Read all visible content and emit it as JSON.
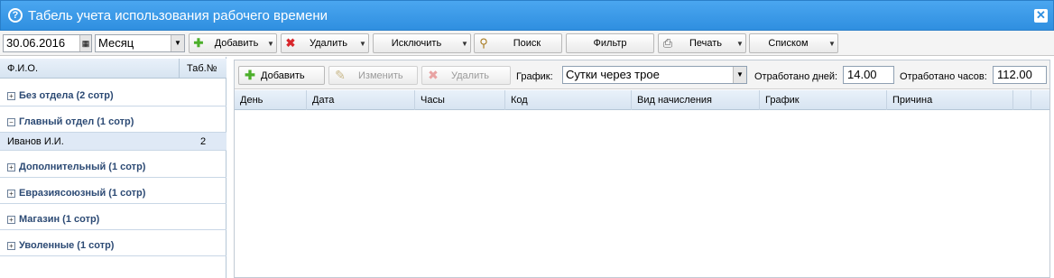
{
  "window": {
    "title": "Табель учета использования рабочего времени",
    "close": "✕",
    "help": "?"
  },
  "toolbar": {
    "date": "30.06.2016",
    "period": "Месяц",
    "add": "Добавить",
    "delete": "Удалить",
    "exclude": "Исключить",
    "search": "Поиск",
    "filter": "Фильтр",
    "print": "Печать",
    "list": "Списком"
  },
  "left": {
    "col_name": "Ф.И.О.",
    "col_tab": "Таб.№",
    "groups": [
      {
        "label": "Без отдела (2 сотр)",
        "toggle": "+"
      },
      {
        "label": "Главный отдел (1 сотр)",
        "toggle": "−"
      },
      {
        "label": "Дополнительный (1 сотр)",
        "toggle": "+"
      },
      {
        "label": "Евразиясоюзный (1 сотр)",
        "toggle": "+"
      },
      {
        "label": "Магазин (1 сотр)",
        "toggle": "+"
      },
      {
        "label": "Уволенные (1 сотр)",
        "toggle": "+"
      }
    ],
    "employee": {
      "name": "Иванов И.И.",
      "tab": "2"
    }
  },
  "right": {
    "add": "Добавить",
    "edit": "Изменить",
    "delete": "Удалить",
    "schedule_label": "График:",
    "schedule_value": "Сутки через трое",
    "days_label": "Отработано дней:",
    "days_value": "14.00",
    "hours_label": "Отработано часов:",
    "hours_value": "112.00",
    "columns": [
      "День",
      "Дата",
      "Часы",
      "Код",
      "Вид начисления",
      "График",
      "Причина"
    ]
  },
  "colors": {
    "titlebar": "#2f8fe0",
    "header": "#d7e4f1",
    "group_text": "#2c4a74",
    "selected_row": "#dfe9f6"
  }
}
